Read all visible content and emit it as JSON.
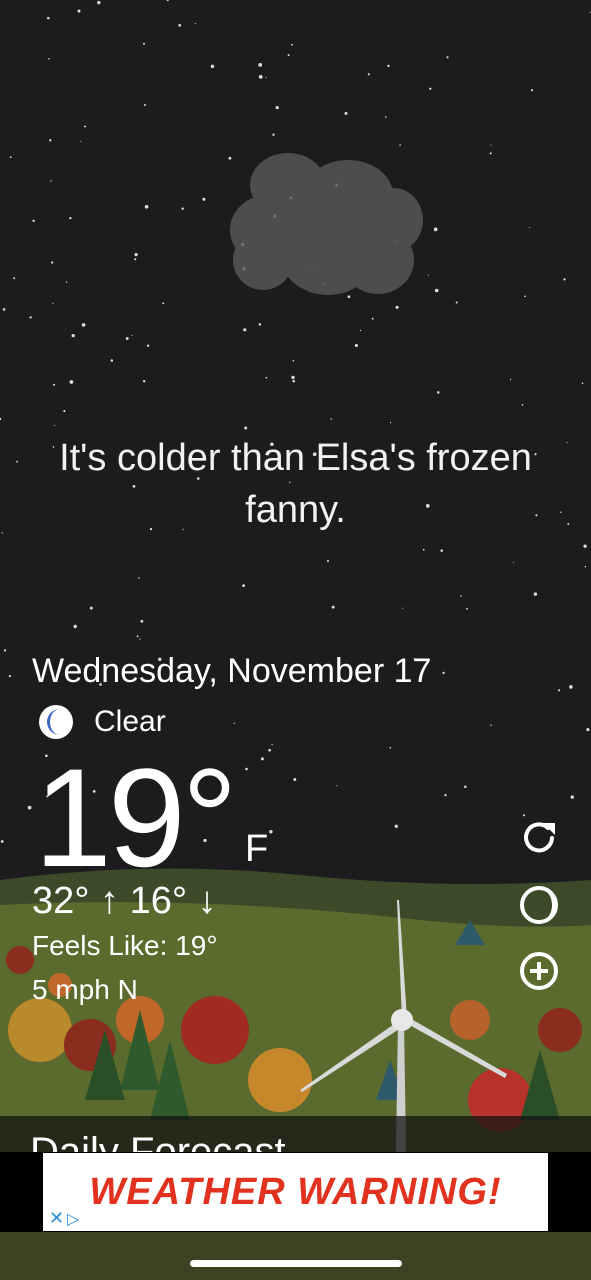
{
  "message": "It's colder than Elsa's frozen fanny.",
  "date": "Wednesday, November 17",
  "condition": {
    "label": "Clear",
    "icon": "moon-icon"
  },
  "temperature": {
    "value": "19°",
    "unit": "F"
  },
  "high_low": "32° ↑  16° ↓",
  "feels_like": "Feels Like: 19°",
  "wind": "5 mph N",
  "side_buttons": [
    "refresh-icon",
    "moon-phase-icon",
    "add-icon"
  ],
  "forecast_title": "Daily Forecast",
  "ad": {
    "text": "WEATHER WARNING!"
  },
  "colors": {
    "sky": "#1c1c1e",
    "hills": "#5b6a2d",
    "moon": "#3a64c8",
    "ad_text": "#e0321e"
  }
}
